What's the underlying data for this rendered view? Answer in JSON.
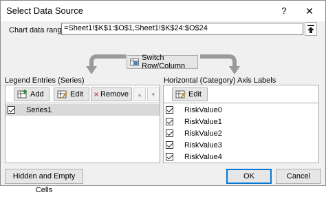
{
  "window": {
    "title": "Select Data Source",
    "help": "?",
    "close": "✕"
  },
  "range": {
    "label": "Chart data range:",
    "value": "=Sheet1!$K$1:$O$1,Sheet1!$K$24:$O$24"
  },
  "switch_button": {
    "label": "Switch Row/Column"
  },
  "legend": {
    "heading": "Legend Entries (Series)",
    "add_label": "Add",
    "edit_label": "Edit",
    "remove_label": "Remove",
    "up_glyph": "▲",
    "down_glyph": "▼",
    "series": [
      {
        "name": "Series1",
        "checked": true
      }
    ]
  },
  "axis": {
    "heading": "Horizontal (Category) Axis Labels",
    "edit_label": "Edit",
    "items": [
      {
        "name": "RiskValue0",
        "checked": true
      },
      {
        "name": "RiskValue1",
        "checked": true
      },
      {
        "name": "RiskValue2",
        "checked": true
      },
      {
        "name": "RiskValue3",
        "checked": true
      },
      {
        "name": "RiskValue4",
        "checked": true
      }
    ]
  },
  "footer": {
    "hidden_cells_label": "Hidden and Empty Cells",
    "ok_label": "OK",
    "cancel_label": "Cancel"
  },
  "colors": {
    "accent": "#0078d7",
    "remove_red": "#d13438",
    "selected_row": "#d9d9d9",
    "arrow_gray": "#9a9a9a"
  }
}
